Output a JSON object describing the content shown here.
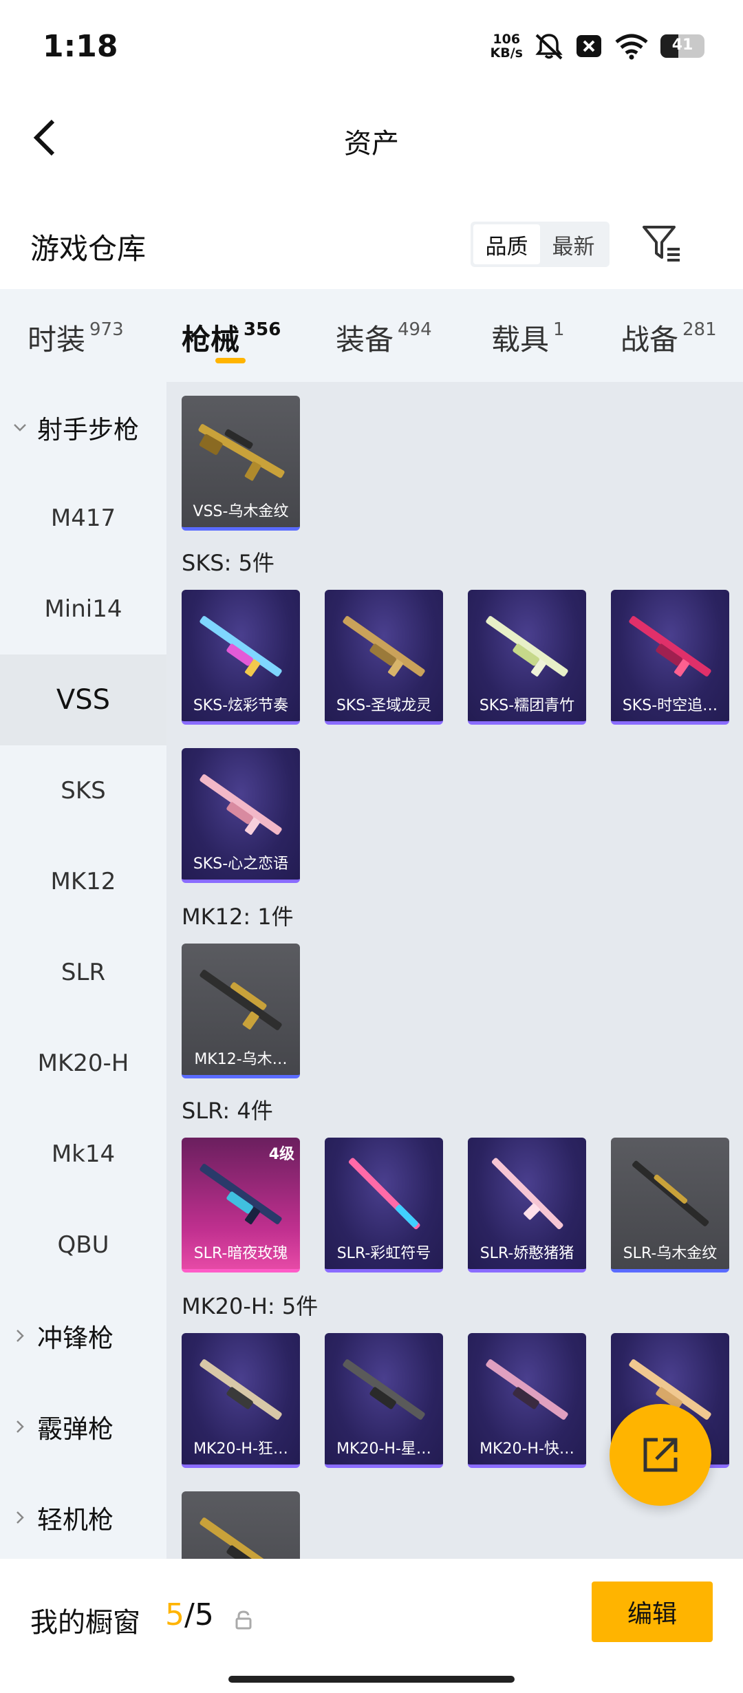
{
  "status_bar": {
    "time": "1:18",
    "net_speed_value": "106",
    "net_speed_unit": "KB/s",
    "battery": "41"
  },
  "nav": {
    "title": "资产"
  },
  "section": {
    "title": "游戏仓库",
    "sort_options": [
      "品质",
      "最新"
    ],
    "active_sort": "品质"
  },
  "tabs": [
    {
      "label": "时装",
      "count": "973"
    },
    {
      "label": "枪械",
      "count": "356",
      "active": true
    },
    {
      "label": "装备",
      "count": "494"
    },
    {
      "label": "载具",
      "count": "1"
    },
    {
      "label": "战备",
      "count": "281"
    }
  ],
  "sidebar": {
    "items": [
      {
        "label": "射手步枪",
        "type": "group",
        "expanded": true
      },
      {
        "label": "M417"
      },
      {
        "label": "Mini14"
      },
      {
        "label": "VSS",
        "active": true
      },
      {
        "label": "SKS"
      },
      {
        "label": "MK12"
      },
      {
        "label": "SLR"
      },
      {
        "label": "MK20-H"
      },
      {
        "label": "Mk14"
      },
      {
        "label": "QBU"
      },
      {
        "label": "冲锋枪",
        "type": "group"
      },
      {
        "label": "霰弹枪",
        "type": "group"
      },
      {
        "label": "轻机枪",
        "type": "group"
      }
    ]
  },
  "content": {
    "vss_item": {
      "name": "VSS-乌木金纹",
      "rarity": "gray"
    },
    "groups": [
      {
        "label": "SKS: 5件",
        "items": [
          {
            "name": "SKS-炫彩节奏",
            "rarity": "purple"
          },
          {
            "name": "SKS-圣域龙灵",
            "rarity": "purple"
          },
          {
            "name": "SKS-糯团青竹",
            "rarity": "purple"
          },
          {
            "name": "SKS-时空追…",
            "rarity": "purple"
          },
          {
            "name": "SKS-心之恋语",
            "rarity": "purple"
          }
        ]
      },
      {
        "label": "MK12: 1件",
        "items": [
          {
            "name": "MK12-乌木…",
            "rarity": "gray"
          }
        ]
      },
      {
        "label": "SLR: 4件",
        "items": [
          {
            "name": "SLR-暗夜玫瑰",
            "rarity": "pink",
            "level": "4级"
          },
          {
            "name": "SLR-彩虹符号",
            "rarity": "purple"
          },
          {
            "name": "SLR-娇憨猪猪",
            "rarity": "purple"
          },
          {
            "name": "SLR-乌木金纹",
            "rarity": "gray"
          }
        ]
      },
      {
        "label": "MK20-H: 5件",
        "items": [
          {
            "name": "MK20-H-狂…",
            "rarity": "purple"
          },
          {
            "name": "MK20-H-星…",
            "rarity": "purple"
          },
          {
            "name": "MK20-H-快…",
            "rarity": "purple"
          },
          {
            "name": "",
            "rarity": "purple"
          },
          {
            "name": "",
            "rarity": "gray"
          }
        ]
      }
    ]
  },
  "bottom_bar": {
    "label": "我的橱窗",
    "current": "5",
    "separator": "/",
    "total": "5",
    "edit_label": "编辑"
  },
  "colors": {
    "accent": "#ffb400",
    "purple_card": "#2b2360",
    "gray_card": "#4f5055",
    "pink_card": "#c0308f"
  }
}
